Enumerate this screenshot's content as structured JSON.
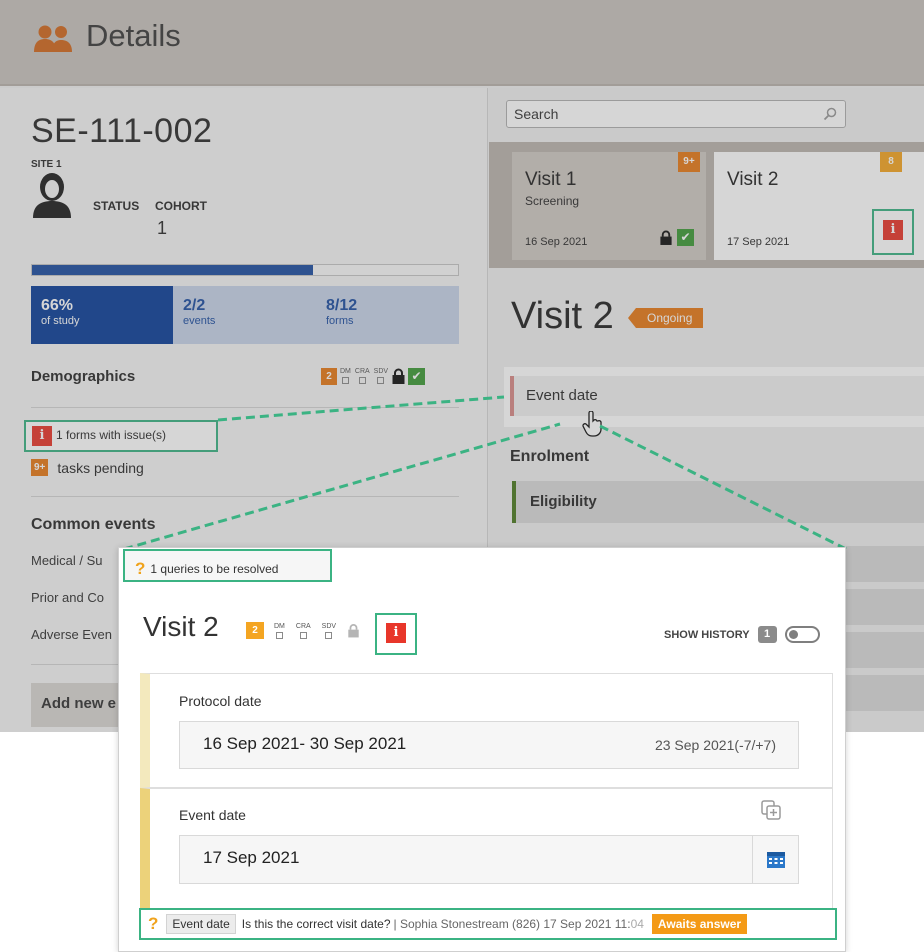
{
  "header": {
    "title": "Details",
    "icon": "people-icon"
  },
  "subject": {
    "id": "SE-111-002",
    "site": "SITE 1",
    "status_label": "STATUS",
    "cohort_label": "COHORT",
    "cohort_value": "1",
    "progress_fraction": 0.66,
    "stats": [
      {
        "value": "66%",
        "label": "of study"
      },
      {
        "value": "2/2",
        "label": "events"
      },
      {
        "value": "8/12",
        "label": "forms"
      }
    ],
    "demographics": {
      "label": "Demographics",
      "count": "2",
      "mini_labels": [
        "DM",
        "CRA",
        "SDV"
      ]
    },
    "issues_text": "1 forms with issue(s)",
    "tasks_badge": "9+",
    "tasks_text": "tasks pending",
    "common_events_label": "Common events",
    "common_events": [
      "Medical / Su",
      "Prior and Co",
      "Adverse Even"
    ],
    "add_new_label": "Add new e"
  },
  "search": {
    "placeholder": "Search"
  },
  "visits": [
    {
      "title": "Visit 1",
      "subtitle": "Screening",
      "date": "16 Sep 2021",
      "badge": "9+"
    },
    {
      "title": "Visit 2",
      "subtitle": "",
      "date": "17 Sep 2021",
      "badge": "8"
    }
  ],
  "visit_detail": {
    "title": "Visit 2",
    "status": "Ongoing",
    "event_date_label": "Event date",
    "enrolment_label": "Enrolment",
    "eligibility_label": "Eligibility"
  },
  "popup": {
    "queries_banner": "1 queries to be resolved",
    "title": "Visit 2",
    "count": "2",
    "mini_labels": [
      "DM",
      "CRA",
      "SDV"
    ],
    "show_history_label": "SHOW HISTORY",
    "history_count": "1",
    "protocol_date_label": "Protocol date",
    "protocol_date_value": "16 Sep 2021- 30 Sep 2021",
    "protocol_date_window": "23 Sep 2021(-7/+7)",
    "event_date_label": "Event date",
    "event_date_value": "17 Sep 2021",
    "query": {
      "field": "Event date",
      "question": "Is this the correct visit date?",
      "author": "| Sophia Stonestream (826) 17 Sep 2021 11:",
      "time_tail": "04",
      "status": "Awaits answer"
    }
  },
  "colors": {
    "highlight": "#3bb383",
    "brand_blue": "#0b3f99",
    "orange": "#e77a18",
    "amber": "#f4a522",
    "danger": "#e8362a",
    "success": "#3d9a36"
  }
}
